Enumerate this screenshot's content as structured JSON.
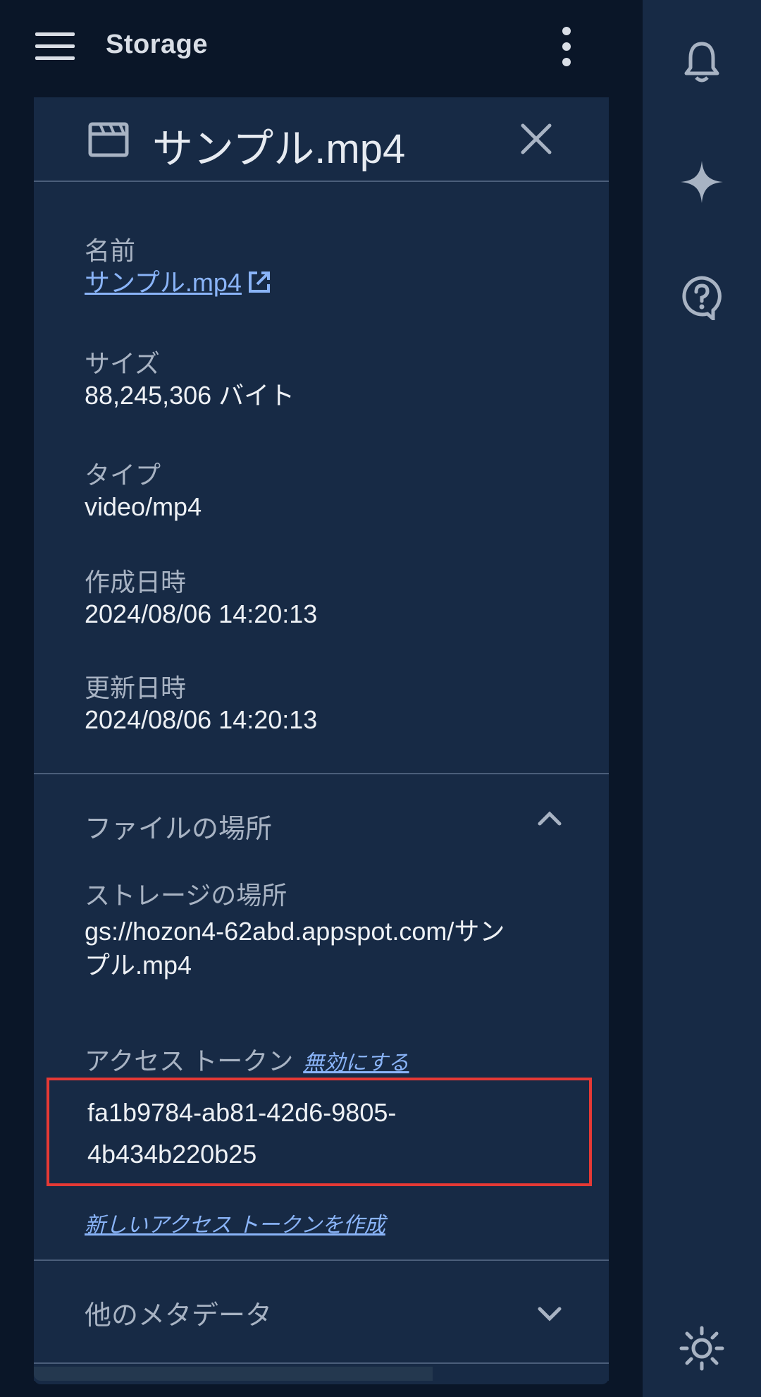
{
  "app_bar": {
    "title": "Storage"
  },
  "panel": {
    "title": "サンプル.mp4",
    "fields": {
      "name_label": "名前",
      "name_value": "サンプル.mp4",
      "size_label": "サイズ",
      "size_value": "88,245,306 バイト",
      "type_label": "タイプ",
      "type_value": "video/mp4",
      "created_label": "作成日時",
      "created_value": "2024/08/06 14:20:13",
      "updated_label": "更新日時",
      "updated_value": "2024/08/06 14:20:13"
    },
    "location_section": {
      "title": "ファイルの場所",
      "storage_label": "ストレージの場所",
      "storage_value_line1": "gs://hozon4-62abd.appspot.com/サン",
      "storage_value_line2": "プル.mp4",
      "token_label": "アクセス トークン",
      "revoke_label": "無効にする",
      "token_line1": "fa1b9784-ab81-42d6-9805-",
      "token_line2": "4b434b220b25",
      "new_token_label": "新しいアクセス トークンを作成"
    },
    "metadata_section": {
      "title": "他のメタデータ"
    }
  },
  "icons": {
    "menu": "menu-icon",
    "more": "more-vert-icon",
    "file": "video-file-icon",
    "close": "close-icon",
    "external_link": "external-link-icon",
    "bell": "bell-icon",
    "sparkle": "sparkle-icon",
    "help": "help-icon",
    "theme": "sun-icon"
  },
  "colors": {
    "background": "#0a1628",
    "panel": "#172a45",
    "link": "#8ab4f8",
    "highlight_border": "#e53935"
  }
}
